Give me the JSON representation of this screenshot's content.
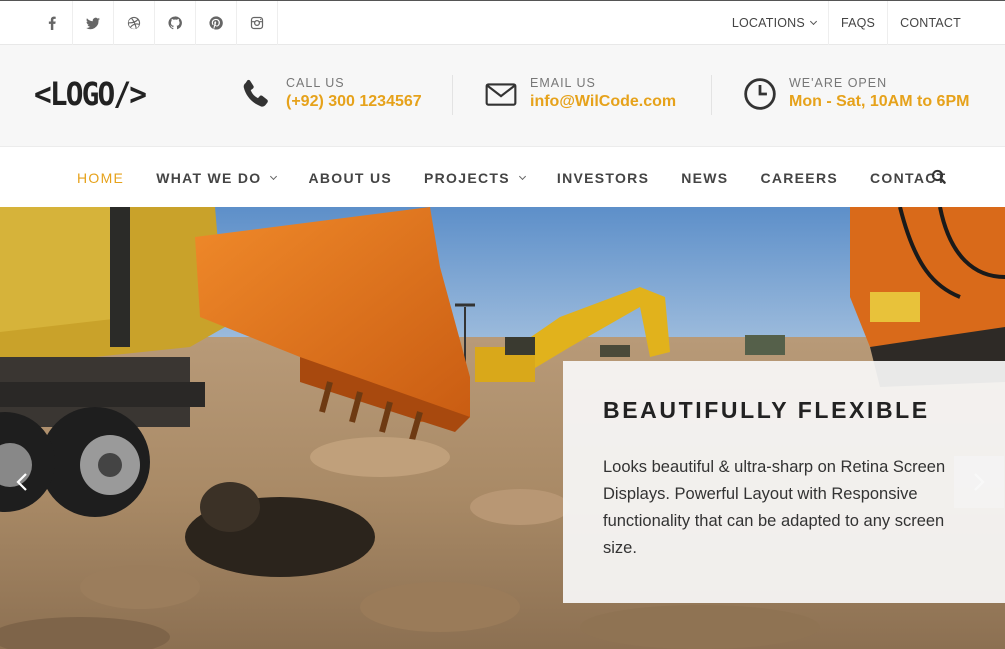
{
  "topbar": {
    "social": [
      {
        "icon": "facebook-icon",
        "glyph": "f"
      },
      {
        "icon": "twitter-icon",
        "glyph": "t"
      },
      {
        "icon": "dribbble-icon",
        "glyph": "d"
      },
      {
        "icon": "github-icon",
        "glyph": "g"
      },
      {
        "icon": "pinterest-icon",
        "glyph": "p"
      },
      {
        "icon": "instagram-icon",
        "glyph": "i"
      }
    ],
    "links": {
      "locations": "LOCATIONS",
      "faqs": "FAQS",
      "contact": "CONTACT"
    }
  },
  "header": {
    "logo": "<LOGO/>",
    "call": {
      "label": "CALL US",
      "value": "(+92) 300 1234567",
      "icon": "phone-icon"
    },
    "email": {
      "label": "EMAIL US",
      "value": "info@WilCode.com",
      "icon": "envelope-icon"
    },
    "hours": {
      "label": "WE'ARE OPEN",
      "value": "Mon - Sat, 10AM to 6PM",
      "icon": "clock-icon"
    }
  },
  "nav": {
    "home": "HOME",
    "what_we_do": "WHAT WE DO",
    "about": "ABOUT US",
    "projects": "PROJECTS",
    "investors": "INVESTORS",
    "news": "NEWS",
    "careers": "CAREERS",
    "contact": "CONTACT"
  },
  "hero": {
    "title": "BEAUTIFULLY FLEXIBLE",
    "text": "Looks beautiful & ultra-sharp on Retina Screen Displays. Powerful Layout with Responsive functionality that can be adapted to any screen size."
  },
  "colors": {
    "accent": "#e6a21b",
    "text": "#333333",
    "header_bg": "#f7f7f7"
  }
}
